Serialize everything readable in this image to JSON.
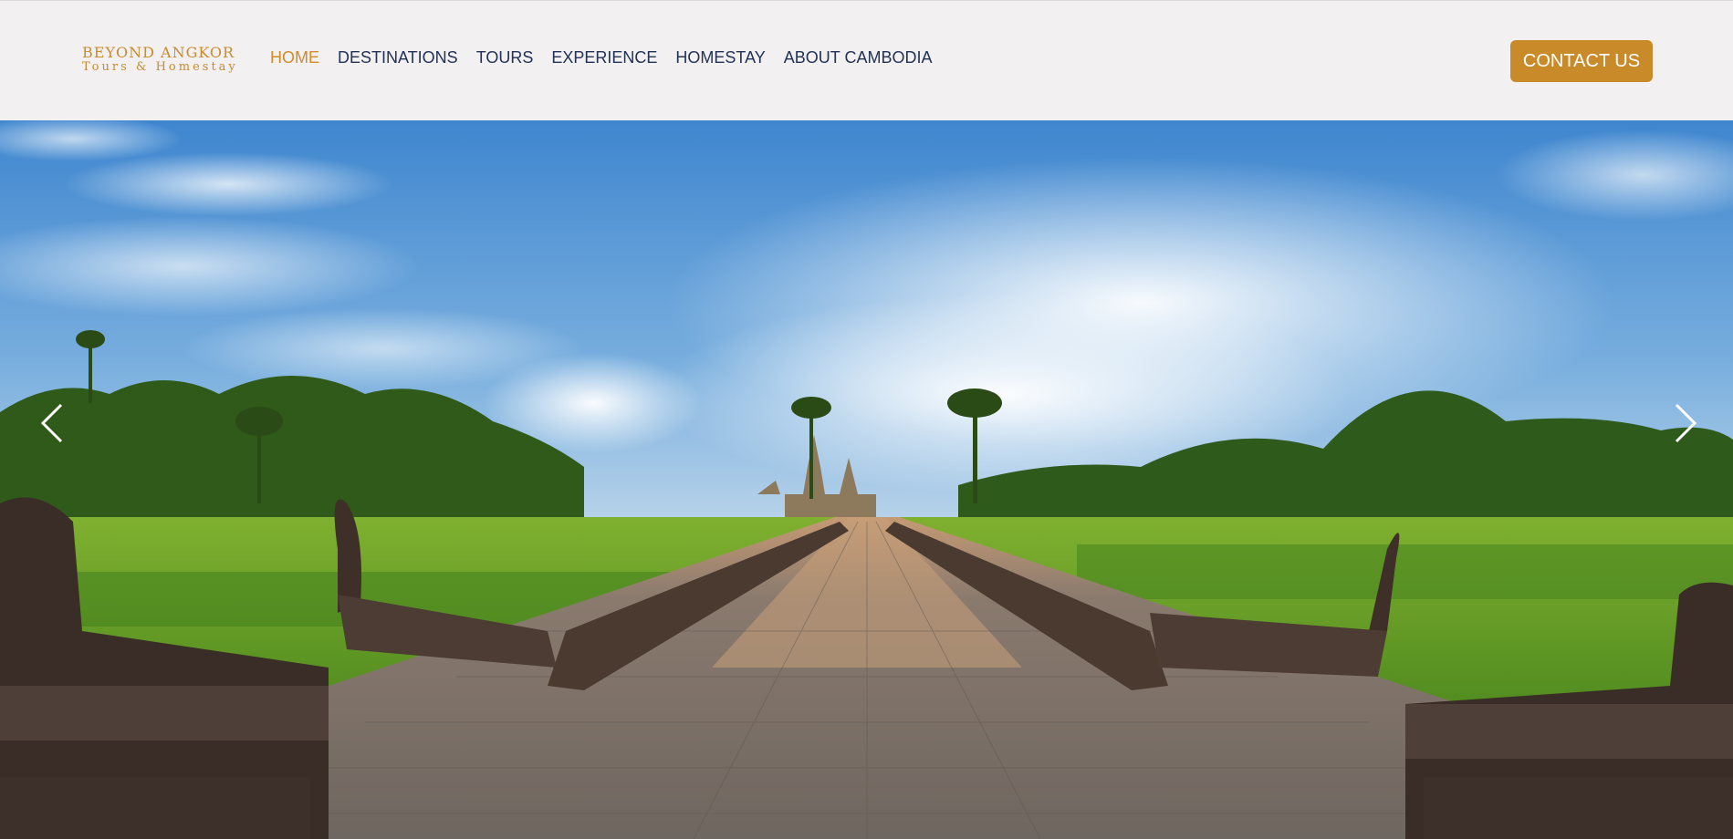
{
  "header": {
    "logo": {
      "title": "BEYOND ANGKOR",
      "subtitle": "Tours & Homestay"
    },
    "nav": [
      {
        "label": "HOME",
        "active": true
      },
      {
        "label": "DESTINATIONS",
        "active": false
      },
      {
        "label": "TOURS",
        "active": false
      },
      {
        "label": "EXPERIENCE",
        "active": false
      },
      {
        "label": "HOMESTAY",
        "active": false
      },
      {
        "label": "ABOUT CAMBODIA",
        "active": false
      }
    ],
    "contact_label": "CONTACT US"
  },
  "hero": {
    "image": "angkor-wat-causeway",
    "prev_icon": "chevron-left-icon",
    "next_icon": "chevron-right-icon"
  },
  "colors": {
    "accent": "#c98b2a",
    "nav_text": "#223355",
    "header_bg": "#f2f0f0"
  }
}
